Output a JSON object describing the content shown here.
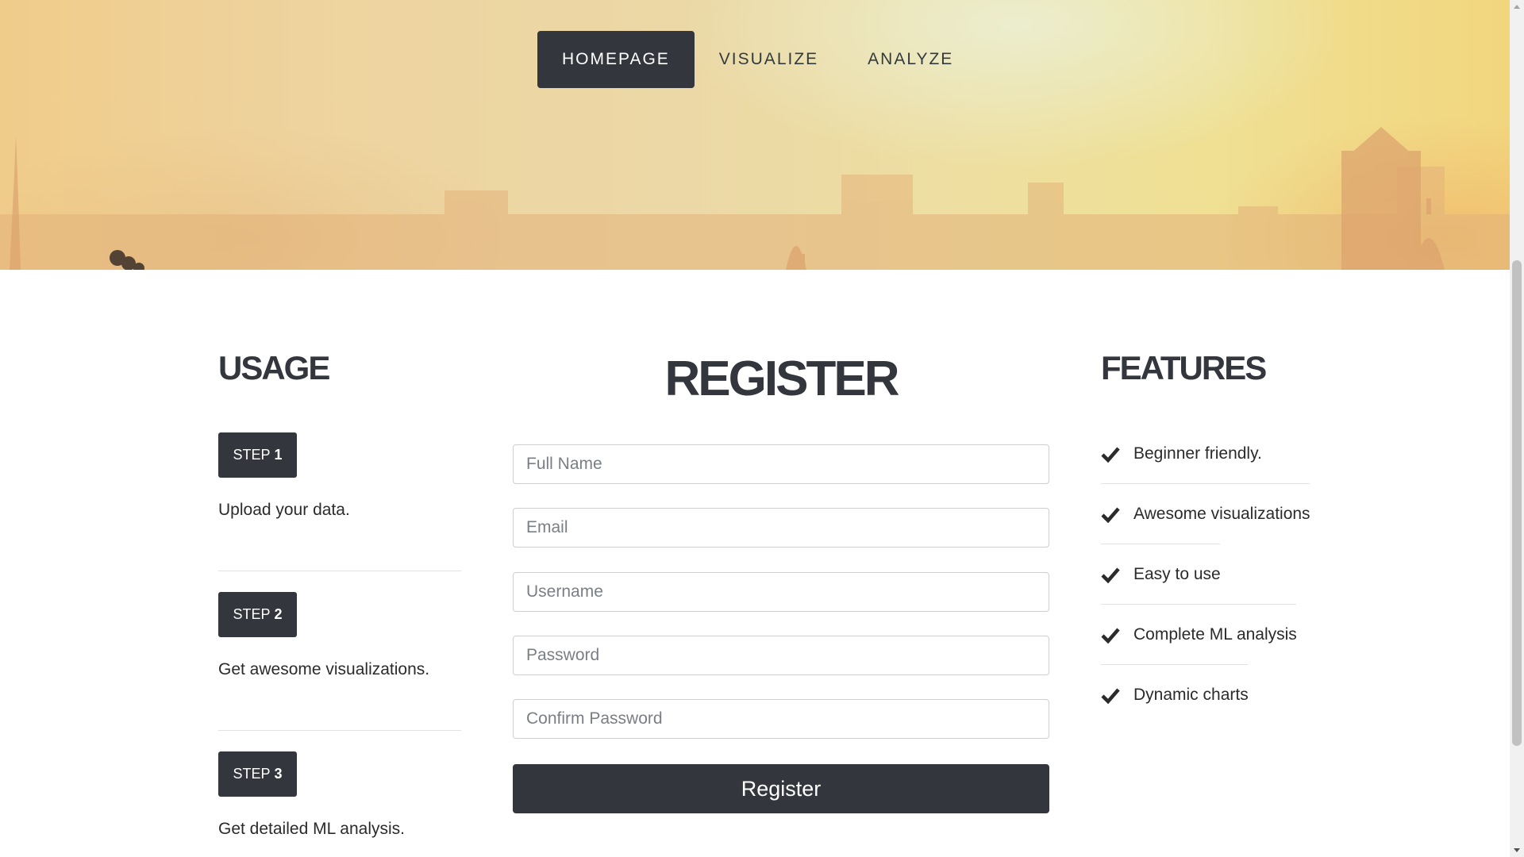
{
  "nav": {
    "items": [
      {
        "label": "HOMEPAGE",
        "active": true
      },
      {
        "label": "VISUALIZE",
        "active": false
      },
      {
        "label": "ANALYZE",
        "active": false
      }
    ]
  },
  "usage": {
    "title": "USAGE",
    "steps": [
      {
        "prefix": "STEP",
        "number": "1",
        "text": "Upload your data."
      },
      {
        "prefix": "STEP",
        "number": "2",
        "text": "Get awesome visualizations."
      },
      {
        "prefix": "STEP",
        "number": "3",
        "text": "Get detailed ML analysis."
      }
    ]
  },
  "register": {
    "title": "REGISTER",
    "fields": {
      "full_name": {
        "placeholder": "Full Name",
        "value": ""
      },
      "email": {
        "placeholder": "Email",
        "value": ""
      },
      "username": {
        "placeholder": "Username",
        "value": ""
      },
      "password": {
        "placeholder": "Password",
        "value": ""
      },
      "confirm_password": {
        "placeholder": "Confirm Password",
        "value": ""
      }
    },
    "submit_label": "Register"
  },
  "features": {
    "title": "FEATURES",
    "items": [
      {
        "text": "Beginner friendly."
      },
      {
        "text": "Awesome visualizations"
      },
      {
        "text": "Easy to use"
      },
      {
        "text": "Complete ML analysis"
      },
      {
        "text": "Dynamic charts"
      }
    ]
  },
  "colors": {
    "dark": "#33363d",
    "text": "#2b2b2b",
    "hero_warm": "#f0cc8a",
    "hero_light": "#eedfa0"
  },
  "icons": {
    "feature_bullet": "checkmark-icon"
  }
}
